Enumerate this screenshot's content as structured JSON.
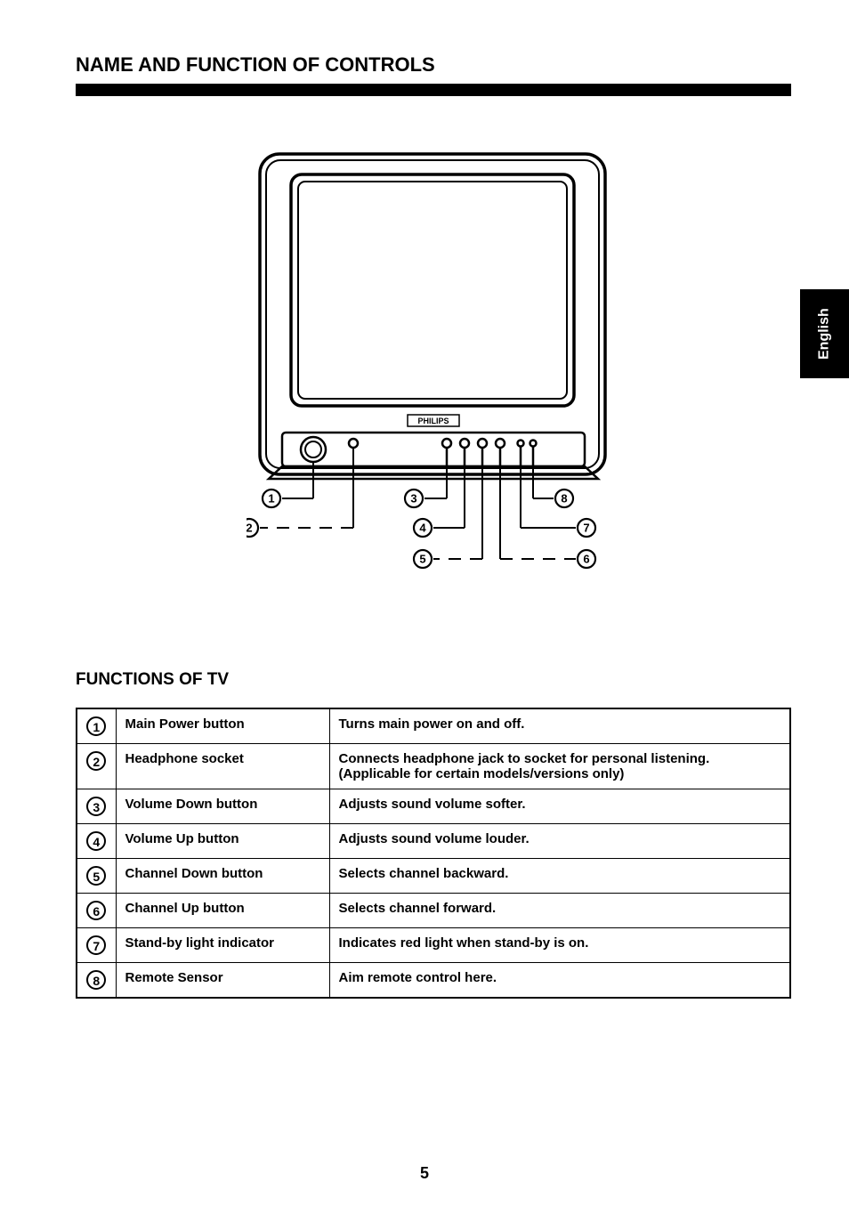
{
  "header": {
    "title": "NAME AND FUNCTION OF CONTROLS"
  },
  "sideTab": "English",
  "diagram": {
    "brandLabel": "PHILIPS",
    "callouts": [
      "1",
      "2",
      "3",
      "4",
      "5",
      "6",
      "7",
      "8"
    ]
  },
  "subtitle": "FUNCTIONS OF TV",
  "functions": [
    {
      "num": "1",
      "name": "Main Power button",
      "desc": "Turns main power on and off."
    },
    {
      "num": "2",
      "name": "Headphone socket",
      "desc": "Connects headphone jack to socket for personal listening. (Applicable for certain models/versions only)"
    },
    {
      "num": "3",
      "name": "Volume Down button",
      "desc": "Adjusts sound volume softer."
    },
    {
      "num": "4",
      "name": "Volume Up button",
      "desc": "Adjusts sound volume louder."
    },
    {
      "num": "5",
      "name": "Channel Down button",
      "desc": "Selects channel backward."
    },
    {
      "num": "6",
      "name": "Channel Up button",
      "desc": "Selects channel forward."
    },
    {
      "num": "7",
      "name": "Stand-by light indicator",
      "desc": "Indicates red light when stand-by is on."
    },
    {
      "num": "8",
      "name": "Remote Sensor",
      "desc": "Aim remote control here."
    }
  ],
  "pageNumber": "5"
}
